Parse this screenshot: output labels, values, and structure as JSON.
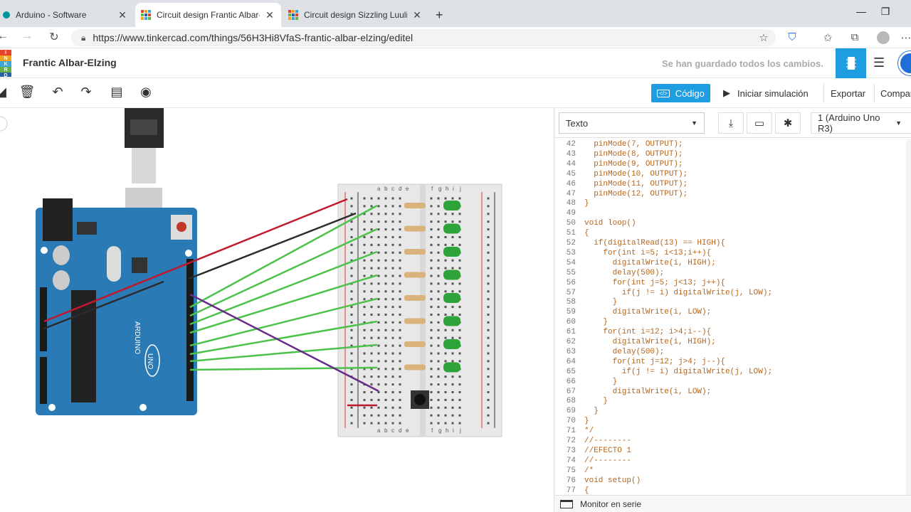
{
  "browser": {
    "tabs": [
      {
        "label": "Arduino - Software",
        "active": false
      },
      {
        "label": "Circuit design Frantic Albar-Elzin",
        "active": true
      },
      {
        "label": "Circuit design Sizzling Luulia-Ro",
        "active": false
      }
    ],
    "close_glyph": "✕",
    "new_tab_glyph": "+",
    "url": "https://www.tinkercad.com/things/56H3Hi8VfaS-frantic-albar-elzing/editel"
  },
  "app": {
    "logo_letters": [
      "I",
      "N",
      "K",
      "R",
      "D"
    ],
    "logo_colors": [
      "#e8412c",
      "#f4a21c",
      "#3aa7d8",
      "#64b346",
      "#2563a8"
    ],
    "project_title": "Frantic Albar-Elzing",
    "save_status": "Se han guardado todos los cambios.",
    "accent_color": "#1e9de0"
  },
  "toolbar": {
    "code_label": "Código",
    "simulate_label": "Iniciar simulación",
    "export_label": "Exportar",
    "share_label": "Compar"
  },
  "code_panel": {
    "mode_value": "Texto",
    "board_value": "1 (Arduino Uno R3)",
    "serial_monitor_label": "Monitor en serie",
    "lines": [
      {
        "n": "42",
        "t": "  pinMode(7, OUTPUT);"
      },
      {
        "n": "43",
        "t": "  pinMode(8, OUTPUT);"
      },
      {
        "n": "44",
        "t": "  pinMode(9, OUTPUT);"
      },
      {
        "n": "45",
        "t": "  pinMode(10, OUTPUT);"
      },
      {
        "n": "46",
        "t": "  pinMode(11, OUTPUT);"
      },
      {
        "n": "47",
        "t": "  pinMode(12, OUTPUT);"
      },
      {
        "n": "48",
        "t": "}"
      },
      {
        "n": "49",
        "t": ""
      },
      {
        "n": "50",
        "t": "void loop()"
      },
      {
        "n": "51",
        "t": "{"
      },
      {
        "n": "52",
        "t": "  if(digitalRead(13) == HIGH){"
      },
      {
        "n": "53",
        "t": "    for(int i=5; i<13;i++){"
      },
      {
        "n": "54",
        "t": "      digitalWrite(i, HIGH);"
      },
      {
        "n": "55",
        "t": "      delay(500);"
      },
      {
        "n": "56",
        "t": "      for(int j=5; j<13; j++){"
      },
      {
        "n": "57",
        "t": "        if(j != i) digitalWrite(j, LOW);"
      },
      {
        "n": "58",
        "t": "      }"
      },
      {
        "n": "59",
        "t": "      digitalWrite(i, LOW);"
      },
      {
        "n": "60",
        "t": "    }"
      },
      {
        "n": "61",
        "t": "    for(int i=12; i>4;i--){"
      },
      {
        "n": "62",
        "t": "      digitalWrite(i, HIGH);"
      },
      {
        "n": "63",
        "t": "      delay(500);"
      },
      {
        "n": "64",
        "t": "      for(int j=12; j>4; j--){"
      },
      {
        "n": "65",
        "t": "        if(j != i) digitalWrite(j, LOW);"
      },
      {
        "n": "66",
        "t": "      }"
      },
      {
        "n": "67",
        "t": "      digitalWrite(i, LOW);"
      },
      {
        "n": "68",
        "t": "    }"
      },
      {
        "n": "69",
        "t": "  }"
      },
      {
        "n": "70",
        "t": "}"
      },
      {
        "n": "71",
        "t": "*/"
      },
      {
        "n": "72",
        "t": "//--------"
      },
      {
        "n": "73",
        "t": "//EFECTO 1"
      },
      {
        "n": "74",
        "t": "//--------"
      },
      {
        "n": "75",
        "t": "/*"
      },
      {
        "n": "76",
        "t": "void setup()"
      },
      {
        "n": "77",
        "t": "{"
      }
    ]
  },
  "circuit": {
    "board_name": "ARDUINO",
    "board_model": "UNO",
    "wire_colors": {
      "red": "#c0192c",
      "black": "#2b2b2b",
      "green": "#4cc24a",
      "purple": "#6a2a8a"
    },
    "breadboard_columns": [
      "a",
      "b",
      "c",
      "d",
      "e",
      "f",
      "g",
      "h",
      "i",
      "j"
    ],
    "led_count": 8
  }
}
